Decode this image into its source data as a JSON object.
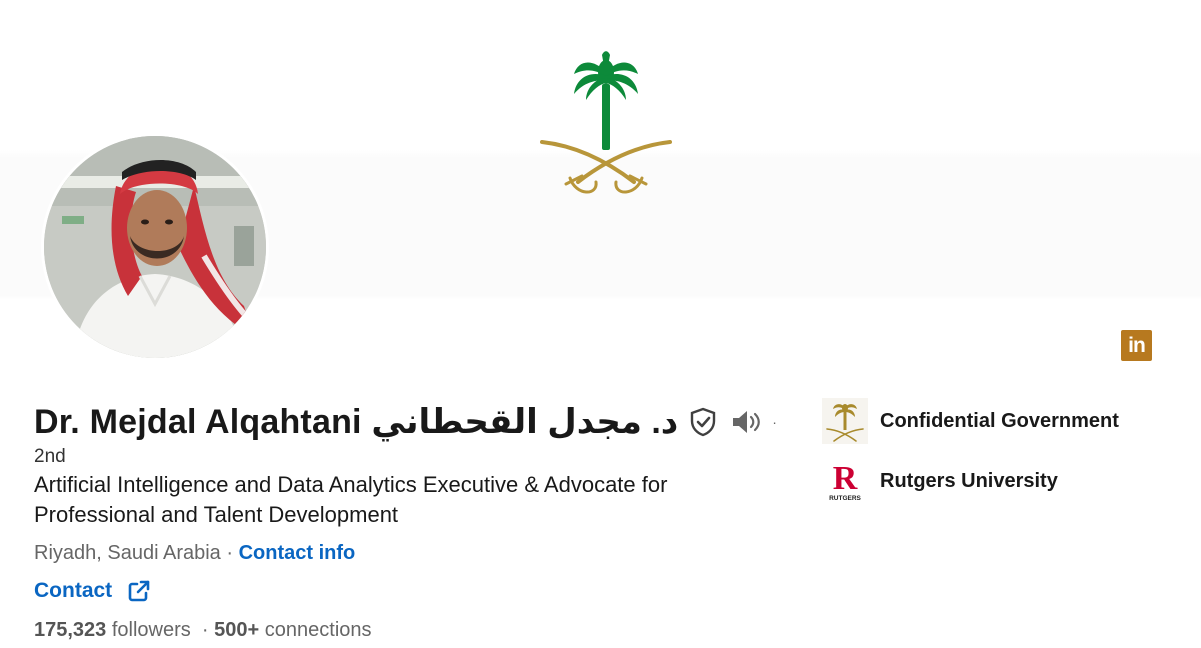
{
  "profile": {
    "name": "Dr. Mejdal Alqahtani د. مجدل القحطاني",
    "degree": "2nd",
    "headline": "Artificial Intelligence and Data Analytics Executive & Advocate for Professional and Talent Development",
    "location": "Riyadh, Saudi Arabia",
    "location_separator": "·",
    "contact_info_label": "Contact info",
    "contact_label": "Contact",
    "followers": "175,323",
    "followers_label": "followers",
    "connections": "500+",
    "connections_label": "connections",
    "stats_separator": "·",
    "name_separator": "·"
  },
  "badge": {
    "text": "in"
  },
  "organizations": [
    {
      "name": "Confidential Government",
      "logo": "saudi-emblem-icon"
    },
    {
      "name": "Rutgers University",
      "logo": "rutgers-r-icon",
      "logo_text": "RUTGERS",
      "logo_letter": "R"
    }
  ],
  "colors": {
    "link": "#0a66c2",
    "text_primary": "#191919",
    "text_secondary": "#666666",
    "emblem_green": "#0d8a3a",
    "emblem_gold": "#b8963a",
    "linkedin_badge": "#b7791f",
    "rutgers_red": "#cc0033"
  },
  "icons": {
    "verified": "verified-shield-icon",
    "pronunciation": "speaker-icon",
    "external_link": "external-link-icon"
  }
}
